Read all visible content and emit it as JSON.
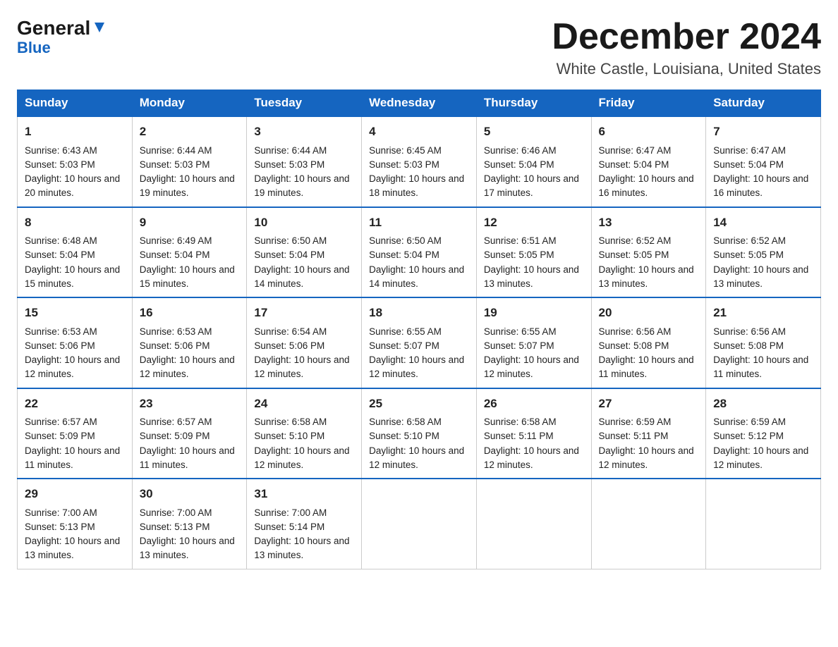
{
  "header": {
    "logo_general": "General",
    "logo_blue": "Blue",
    "month_title": "December 2024",
    "location": "White Castle, Louisiana, United States"
  },
  "days_of_week": [
    "Sunday",
    "Monday",
    "Tuesday",
    "Wednesday",
    "Thursday",
    "Friday",
    "Saturday"
  ],
  "weeks": [
    [
      {
        "day": 1,
        "sunrise": "6:43 AM",
        "sunset": "5:03 PM",
        "daylight": "10 hours and 20 minutes."
      },
      {
        "day": 2,
        "sunrise": "6:44 AM",
        "sunset": "5:03 PM",
        "daylight": "10 hours and 19 minutes."
      },
      {
        "day": 3,
        "sunrise": "6:44 AM",
        "sunset": "5:03 PM",
        "daylight": "10 hours and 19 minutes."
      },
      {
        "day": 4,
        "sunrise": "6:45 AM",
        "sunset": "5:03 PM",
        "daylight": "10 hours and 18 minutes."
      },
      {
        "day": 5,
        "sunrise": "6:46 AM",
        "sunset": "5:04 PM",
        "daylight": "10 hours and 17 minutes."
      },
      {
        "day": 6,
        "sunrise": "6:47 AM",
        "sunset": "5:04 PM",
        "daylight": "10 hours and 16 minutes."
      },
      {
        "day": 7,
        "sunrise": "6:47 AM",
        "sunset": "5:04 PM",
        "daylight": "10 hours and 16 minutes."
      }
    ],
    [
      {
        "day": 8,
        "sunrise": "6:48 AM",
        "sunset": "5:04 PM",
        "daylight": "10 hours and 15 minutes."
      },
      {
        "day": 9,
        "sunrise": "6:49 AM",
        "sunset": "5:04 PM",
        "daylight": "10 hours and 15 minutes."
      },
      {
        "day": 10,
        "sunrise": "6:50 AM",
        "sunset": "5:04 PM",
        "daylight": "10 hours and 14 minutes."
      },
      {
        "day": 11,
        "sunrise": "6:50 AM",
        "sunset": "5:04 PM",
        "daylight": "10 hours and 14 minutes."
      },
      {
        "day": 12,
        "sunrise": "6:51 AM",
        "sunset": "5:05 PM",
        "daylight": "10 hours and 13 minutes."
      },
      {
        "day": 13,
        "sunrise": "6:52 AM",
        "sunset": "5:05 PM",
        "daylight": "10 hours and 13 minutes."
      },
      {
        "day": 14,
        "sunrise": "6:52 AM",
        "sunset": "5:05 PM",
        "daylight": "10 hours and 13 minutes."
      }
    ],
    [
      {
        "day": 15,
        "sunrise": "6:53 AM",
        "sunset": "5:06 PM",
        "daylight": "10 hours and 12 minutes."
      },
      {
        "day": 16,
        "sunrise": "6:53 AM",
        "sunset": "5:06 PM",
        "daylight": "10 hours and 12 minutes."
      },
      {
        "day": 17,
        "sunrise": "6:54 AM",
        "sunset": "5:06 PM",
        "daylight": "10 hours and 12 minutes."
      },
      {
        "day": 18,
        "sunrise": "6:55 AM",
        "sunset": "5:07 PM",
        "daylight": "10 hours and 12 minutes."
      },
      {
        "day": 19,
        "sunrise": "6:55 AM",
        "sunset": "5:07 PM",
        "daylight": "10 hours and 12 minutes."
      },
      {
        "day": 20,
        "sunrise": "6:56 AM",
        "sunset": "5:08 PM",
        "daylight": "10 hours and 11 minutes."
      },
      {
        "day": 21,
        "sunrise": "6:56 AM",
        "sunset": "5:08 PM",
        "daylight": "10 hours and 11 minutes."
      }
    ],
    [
      {
        "day": 22,
        "sunrise": "6:57 AM",
        "sunset": "5:09 PM",
        "daylight": "10 hours and 11 minutes."
      },
      {
        "day": 23,
        "sunrise": "6:57 AM",
        "sunset": "5:09 PM",
        "daylight": "10 hours and 11 minutes."
      },
      {
        "day": 24,
        "sunrise": "6:58 AM",
        "sunset": "5:10 PM",
        "daylight": "10 hours and 12 minutes."
      },
      {
        "day": 25,
        "sunrise": "6:58 AM",
        "sunset": "5:10 PM",
        "daylight": "10 hours and 12 minutes."
      },
      {
        "day": 26,
        "sunrise": "6:58 AM",
        "sunset": "5:11 PM",
        "daylight": "10 hours and 12 minutes."
      },
      {
        "day": 27,
        "sunrise": "6:59 AM",
        "sunset": "5:11 PM",
        "daylight": "10 hours and 12 minutes."
      },
      {
        "day": 28,
        "sunrise": "6:59 AM",
        "sunset": "5:12 PM",
        "daylight": "10 hours and 12 minutes."
      }
    ],
    [
      {
        "day": 29,
        "sunrise": "7:00 AM",
        "sunset": "5:13 PM",
        "daylight": "10 hours and 13 minutes."
      },
      {
        "day": 30,
        "sunrise": "7:00 AM",
        "sunset": "5:13 PM",
        "daylight": "10 hours and 13 minutes."
      },
      {
        "day": 31,
        "sunrise": "7:00 AM",
        "sunset": "5:14 PM",
        "daylight": "10 hours and 13 minutes."
      },
      null,
      null,
      null,
      null
    ]
  ]
}
